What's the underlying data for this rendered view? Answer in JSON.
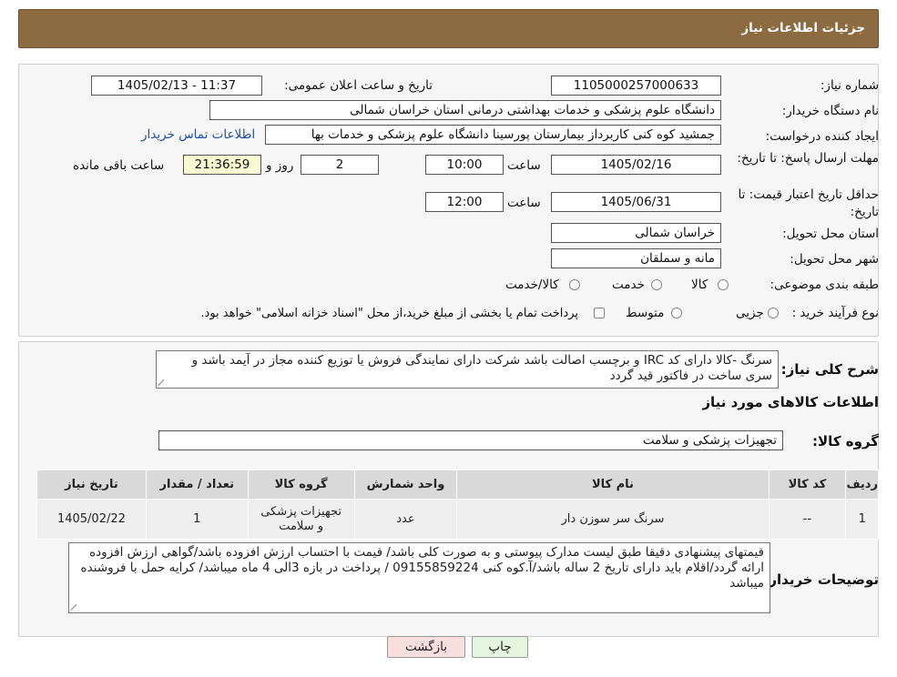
{
  "header": {
    "title": "جزئیات اطلاعات نیاز"
  },
  "fields": {
    "need_number_label": "شماره نیاز:",
    "need_number": "1105000257000633",
    "announce_label": "تاریخ و ساعت اعلان عمومی:",
    "announce_value": "1405/02/13 - 11:37",
    "buyer_org_label": "نام دستگاه خریدار:",
    "buyer_org": "دانشگاه علوم پزشکی و خدمات بهداشتی درمانی استان خراسان شمالی",
    "requester_label": "ایجاد کننده درخواست:",
    "requester": "جمشید کوه کنی کاربرداز بیمارستان پورسینا دانشگاه علوم پزشکی و خدمات بها",
    "contact_link": "اطلاعات تماس خریدار",
    "deadline_label": "مهلت ارسال پاسخ: تا تاریخ:",
    "deadline_date": "1405/02/16",
    "time_label": "ساعت",
    "deadline_time": "10:00",
    "days_value": "2",
    "days_label": "روز و",
    "remaining_time": "21:36:59",
    "remaining_label": "ساعت باقی مانده",
    "validity_label": "حداقل تاریخ اعتبار قیمت: تا تاریخ:",
    "validity_date": "1405/06/31",
    "validity_time": "12:00",
    "province_label": "استان محل تحویل:",
    "province": "خراسان شمالی",
    "city_label": "شهر محل تحویل:",
    "city": "مانه و سملقان",
    "category_label": "طبقه بندی موضوعی:",
    "category_options": [
      "کالا",
      "خدمت",
      "کالا/خدمت"
    ],
    "purchase_type_label": "نوع فرآیند خرید :",
    "purchase_options": [
      "جزیی",
      "متوسط"
    ],
    "purchase_note": "پرداخت تمام یا بخشی از مبلغ خرید،از محل \"اسناد خزانه اسلامی\" خواهد بود."
  },
  "description": {
    "label": "شرح کلی نیاز:",
    "text": "سرنگ -کالا دارای کد IRC و برچسب اصالت باشد شرکت دارای نمایندگی فروش یا توزیع کننده  مجاز در آیمد باشد و سری ساخت در فاکتور قید گردد"
  },
  "goods_section": {
    "title": "اطلاعات کالاهای مورد نیاز"
  },
  "goods_group": {
    "label": "گروه کالا:",
    "value": "تجهیزات پزشکی و سلامت"
  },
  "table": {
    "headers": [
      "ردیف",
      "کد کالا",
      "نام کالا",
      "واحد شمارش",
      "گروه کالا",
      "تعداد / مقدار",
      "تاریخ نیاز"
    ],
    "rows": [
      [
        "1",
        "--",
        "سرنگ سر سوزن دار",
        "عدد",
        "تجهیزات پزشکی و سلامت",
        "1",
        "1405/02/22"
      ]
    ]
  },
  "buyer_notes": {
    "label": "توضیحات خریدار:",
    "text": "قیمتهای پیشنهادی دقیقا طبق لیست مدارک پیوستی و به صورت کلی باشد/ قیمت با احتساب ارزش افزوده باشد/گواهی ارزش افزوده ارائه گردد/اقلام باید دارای تاریخ 2 ساله باشد/آ.کوه کنی 09155859224 / پرداخت در بازه 3الی 4 ماه میباشد/ کرایه حمل با فروشنده میباشد"
  },
  "buttons": {
    "print": "چاپ",
    "back": "بازگشت"
  },
  "colors": {
    "header": "#8b6b3f",
    "link": "#1f4fa8",
    "back_button": "#f9dede",
    "print_button": "#e6f5e0"
  }
}
